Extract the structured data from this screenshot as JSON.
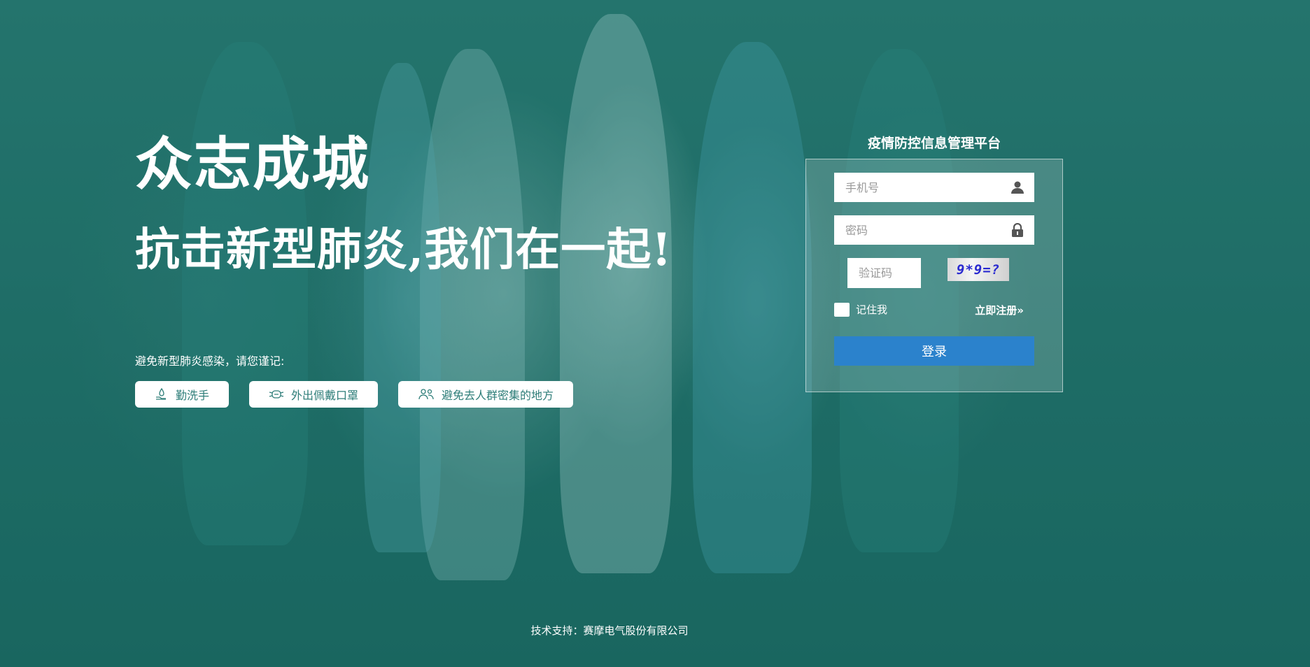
{
  "hero": {
    "title": "众志成城",
    "subtitle": "抗击新型肺炎,我们在一起!",
    "reminder": "避免新型肺炎感染，请您谨记:",
    "tips": [
      {
        "label": "勤洗手",
        "icon": "hand-wash-icon"
      },
      {
        "label": "外出佩戴口罩",
        "icon": "mask-icon"
      },
      {
        "label": "避免去人群密集的地方",
        "icon": "people-icon"
      }
    ]
  },
  "login": {
    "title": "疫情防控信息管理平台",
    "phone_placeholder": "手机号",
    "password_placeholder": "密码",
    "captcha_placeholder": "验证码",
    "captcha_text": "9*9=?",
    "remember_label": "记住我",
    "register_label": "立即注册»",
    "submit_label": "登录"
  },
  "footer": {
    "text": "技术支持：赛摩电气股份有限公司"
  },
  "colors": {
    "background": "#1d6e68",
    "button": "#2b82cc",
    "tip_text": "#2d7d78"
  }
}
